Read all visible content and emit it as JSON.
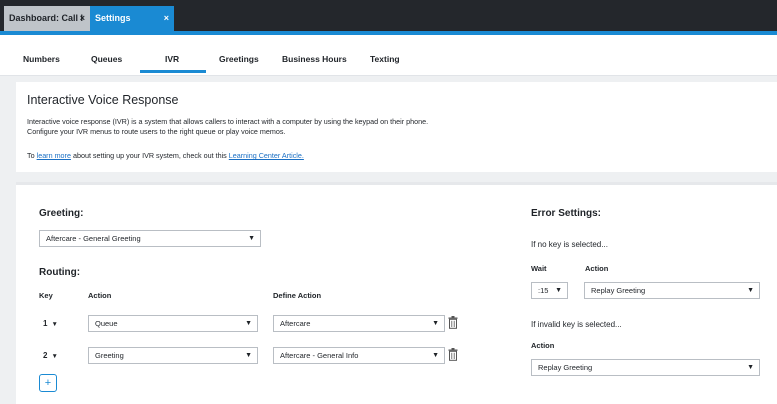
{
  "tabs": [
    {
      "label": "Dashboard: Call I",
      "close": "×"
    },
    {
      "label": "Settings",
      "close": "×"
    }
  ],
  "nav": [
    "Numbers",
    "Queues",
    "IVR",
    "Greetings",
    "Business Hours",
    "Texting"
  ],
  "info": {
    "title": "Interactive Voice Response",
    "line1": "Interactive voice response (IVR) is a system that allows callers to interact with a computer by using the keypad on their phone.",
    "line2": "Configure your IVR menus to route users to the right queue or play voice memos.",
    "more_prefix": "To ",
    "more_link": "learn more",
    "more_mid": " about setting up your IVR system, check out this ",
    "article_link": "Learning Center Article."
  },
  "greeting": {
    "heading": "Greeting:",
    "value": "Aftercare - General Greeting"
  },
  "routing": {
    "heading": "Routing:",
    "col_key": "Key",
    "col_action": "Action",
    "col_define": "Define Action",
    "rows": [
      {
        "key": "1",
        "action": "Queue",
        "define": "Aftercare"
      },
      {
        "key": "2",
        "action": "Greeting",
        "define": "Aftercare - General Info"
      }
    ],
    "add_label": "+"
  },
  "errors": {
    "heading": "Error Settings:",
    "no_key_text": "If no key is selected...",
    "wait_label": "Wait",
    "action_label": "Action",
    "wait_value": ":15",
    "no_key_action": "Replay Greeting",
    "invalid_text": "If invalid key is selected...",
    "invalid_action_label": "Action",
    "invalid_action": "Replay Greeting"
  },
  "colors": {
    "accent": "#1a8ad3",
    "tabbar": "#24272c",
    "link": "#1a6fc4"
  }
}
